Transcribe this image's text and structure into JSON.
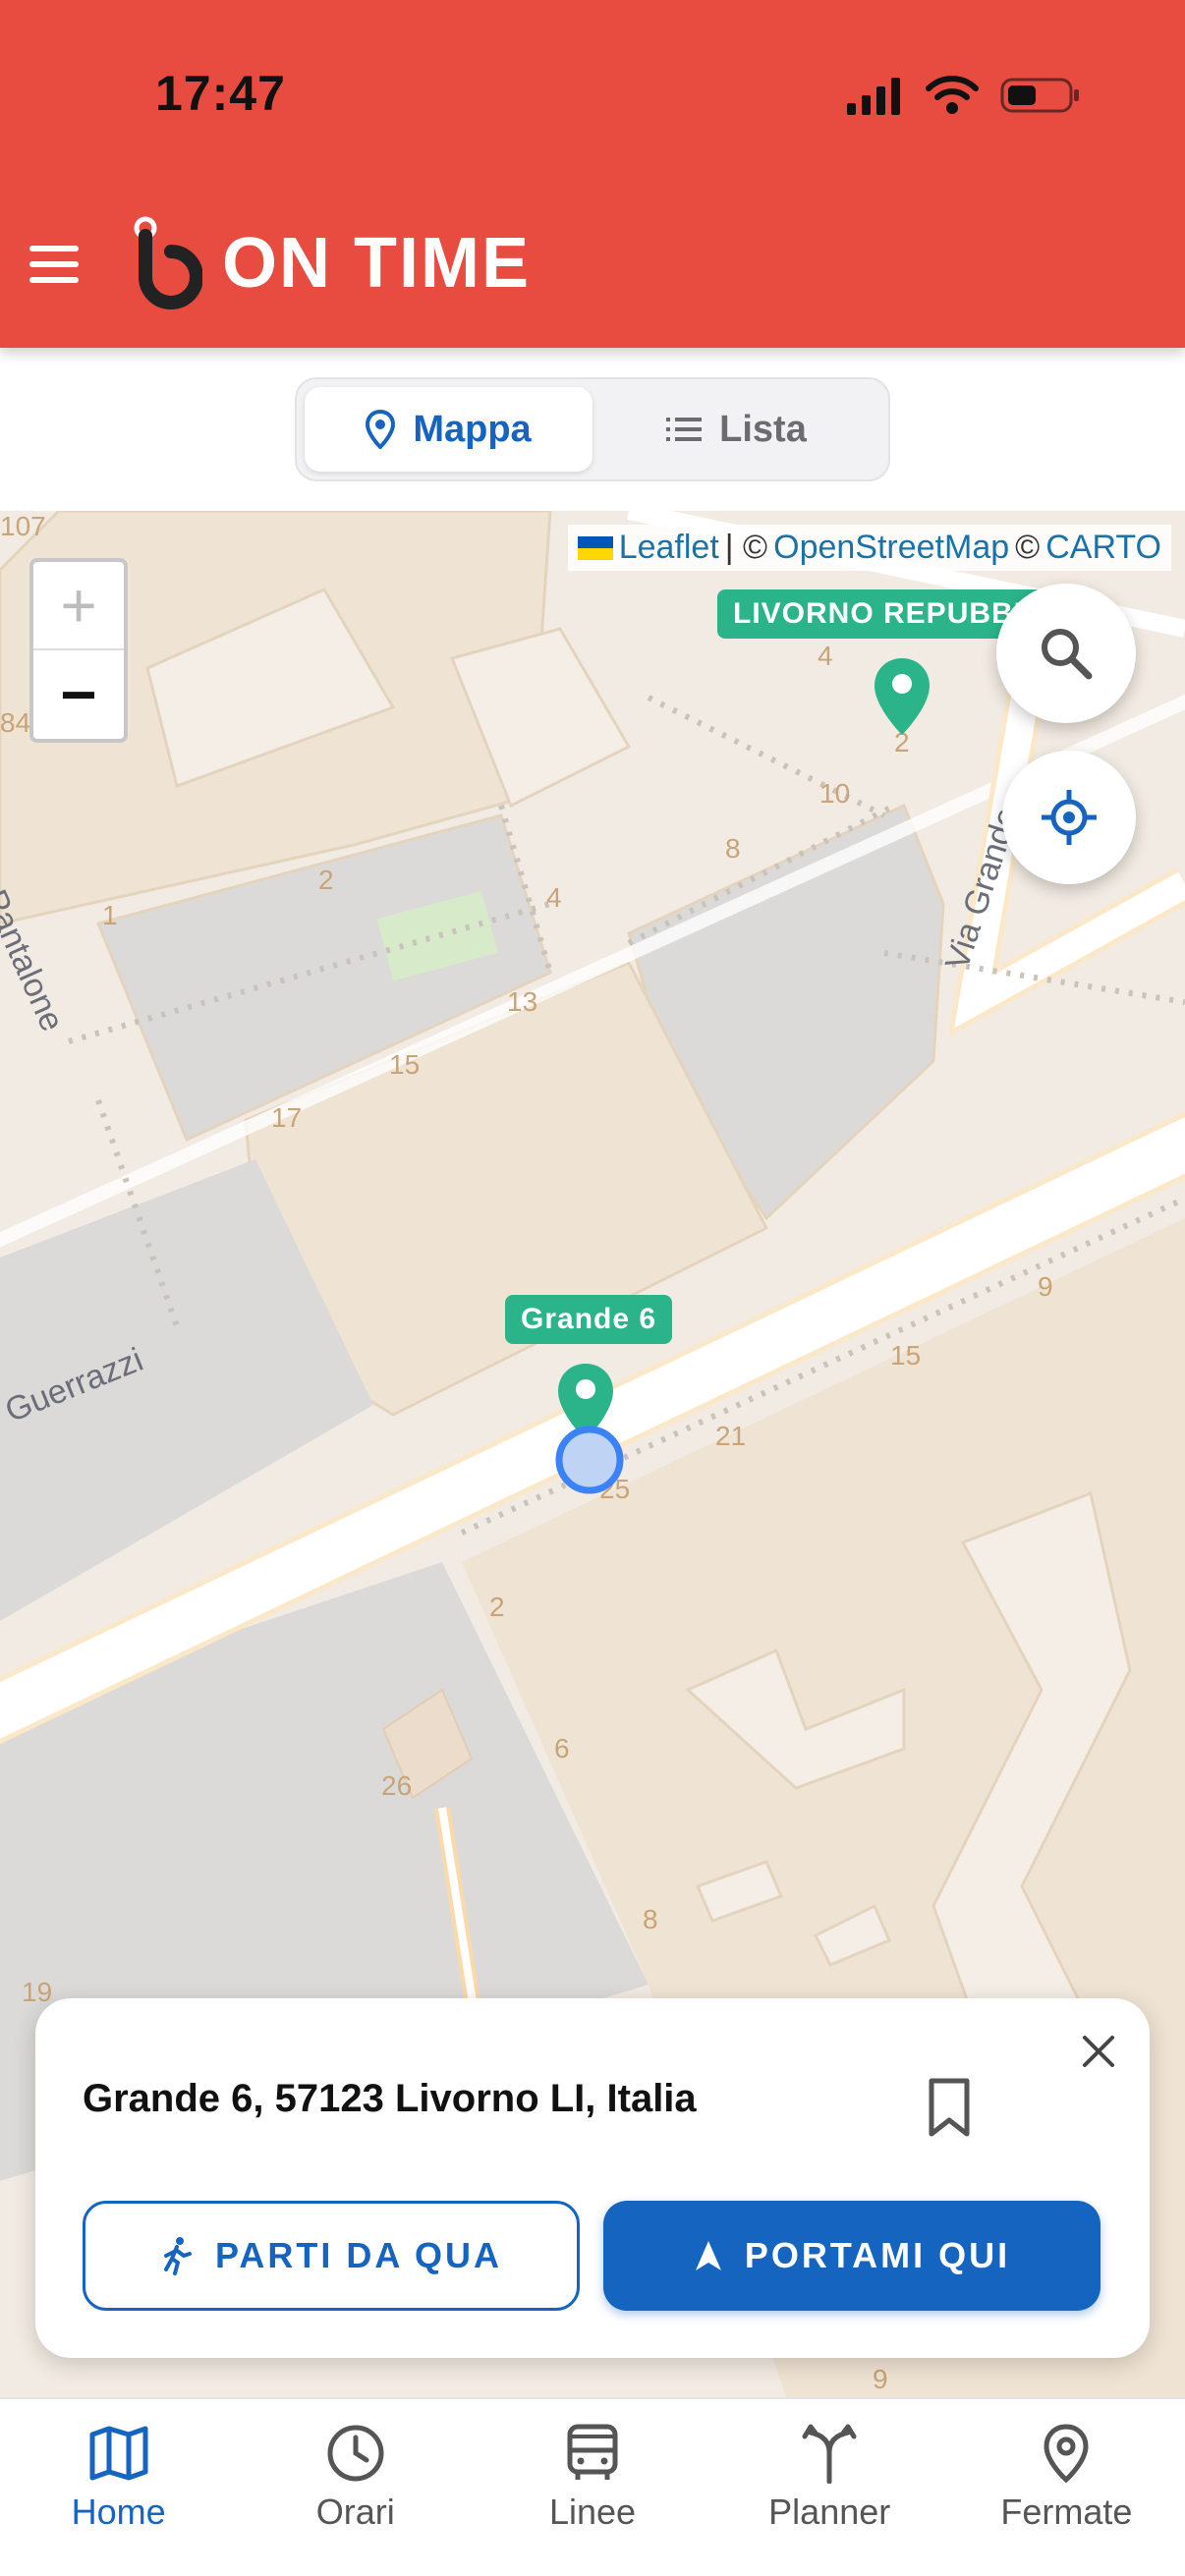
{
  "status_bar": {
    "time": "17:47"
  },
  "header": {
    "app_name": "ON TIME"
  },
  "view_toggle": {
    "map_label": "Mappa",
    "list_label": "Lista"
  },
  "map": {
    "attribution": {
      "leaflet": "Leaflet",
      "sep1": "| ©",
      "osm": "OpenStreetMap",
      "sep2": "©",
      "carto": "CARTO"
    },
    "zoom": {
      "in": "+",
      "out": "−"
    },
    "stops": [
      {
        "label": "LIVORNO REPUBBL"
      },
      {
        "label": "Grande 6"
      }
    ],
    "streets": {
      "via_grande": "Via Grande",
      "pantalone": "Pantalone",
      "guerrazzi": "Guerrazzi"
    },
    "house_numbers": [
      "107",
      "84",
      "4",
      "2",
      "10",
      "8",
      "4",
      "2",
      "1",
      "13",
      "15",
      "17",
      "9",
      "15",
      "21",
      "25",
      "2",
      "6",
      "26",
      "8",
      "19",
      "9"
    ]
  },
  "place_card": {
    "address": "Grande 6, 57123 Livorno LI, Italia",
    "start_here_label": "PARTI DA QUA",
    "take_me_label": "PORTAMI QUI"
  },
  "bottom_nav": [
    {
      "label": "Home",
      "icon": "map-icon",
      "active": true
    },
    {
      "label": "Orari",
      "icon": "clock-icon",
      "active": false
    },
    {
      "label": "Linee",
      "icon": "bus-icon",
      "active": false
    },
    {
      "label": "Planner",
      "icon": "route-split-icon",
      "active": false
    },
    {
      "label": "Fermate",
      "icon": "location-pin-icon",
      "active": false
    }
  ],
  "colors": {
    "header": "#E84B3F",
    "primary": "#1565C0",
    "stop": "#2BB48A"
  }
}
